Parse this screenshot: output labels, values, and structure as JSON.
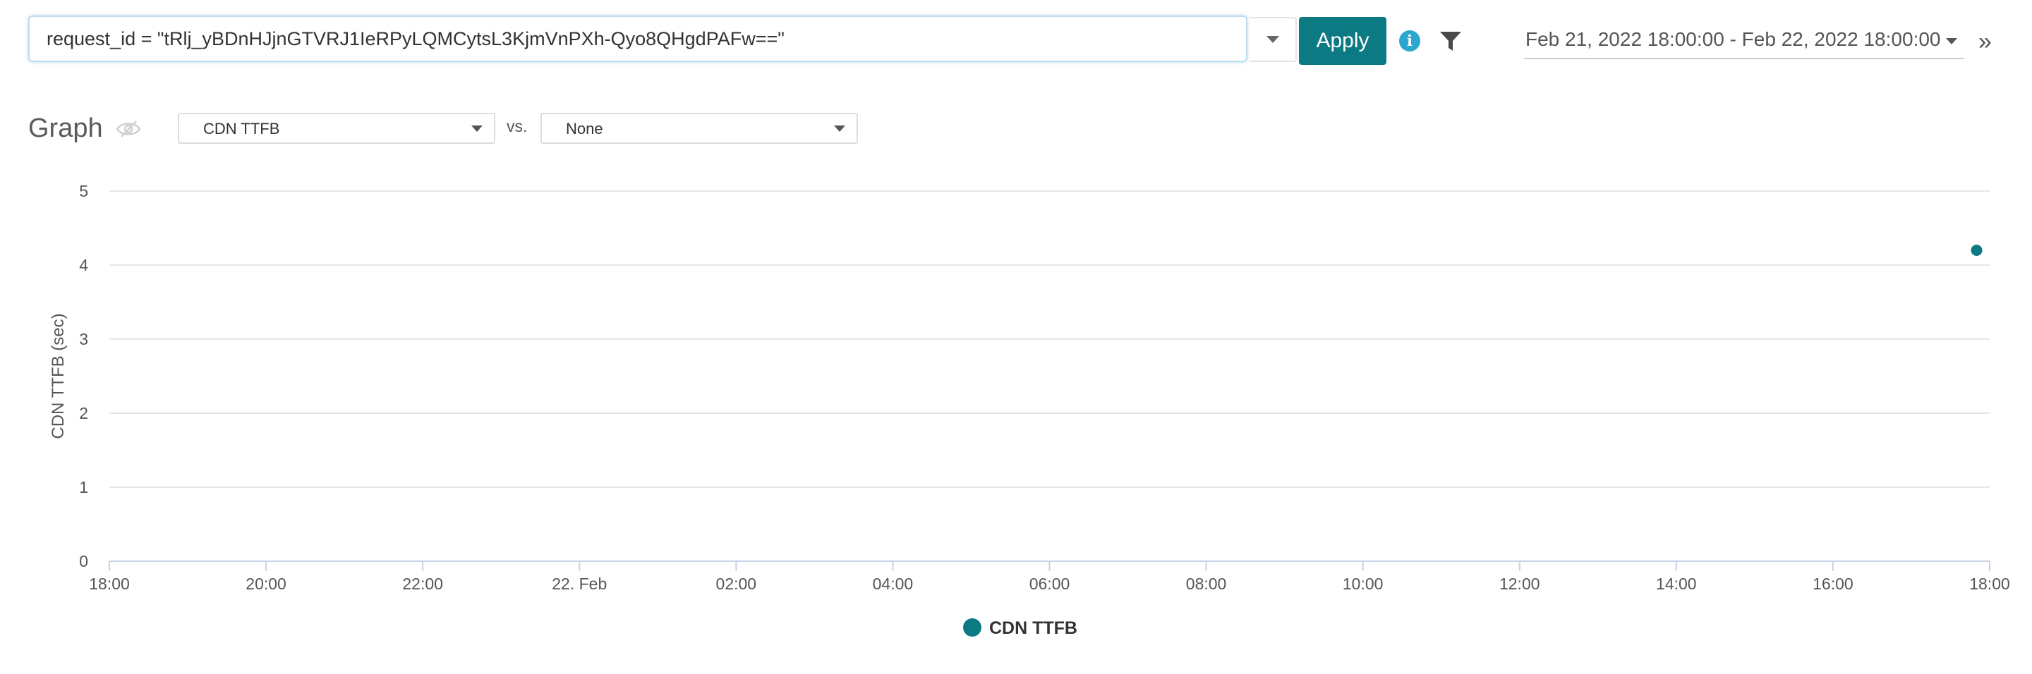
{
  "query": {
    "value": "request_id = \"tRlj_yBDnHJjnGTVRJ1IeRPyLQMCytsL3KjmVnPXh-Qyo8QHgdPAFw==\"",
    "apply_label": "Apply"
  },
  "date_range": {
    "label": "Feb 21, 2022 18:00:00 - Feb 22, 2022 18:00:00"
  },
  "icons": {
    "info": "info-icon",
    "filter": "filter-icon",
    "collapse": "double-chevron-right-icon",
    "visibility": "eye-slash-icon",
    "dropdown": "caret-down-icon",
    "info_glyph": "i",
    "collapse_glyph": "»"
  },
  "graph": {
    "title": "Graph",
    "metric_selected": "CDN TTFB",
    "vs_label": "vs.",
    "compare_selected": "None"
  },
  "colors": {
    "accent": "#0b7a83",
    "info": "#2aa7cf",
    "series": "#0b7a83",
    "grid": "#e6e6e6"
  },
  "chart_data": {
    "type": "scatter",
    "ylabel": "CDN TTFB (sec)",
    "xlabel": "",
    "ylim": [
      0,
      5
    ],
    "yticks": [
      "0",
      "1",
      "2",
      "3",
      "4",
      "5"
    ],
    "xlim": [
      "2022-02-21 18:00",
      "2022-02-22 18:00"
    ],
    "xticks": [
      "18:00",
      "20:00",
      "22:00",
      "22. Feb",
      "02:00",
      "04:00",
      "06:00",
      "08:00",
      "10:00",
      "12:00",
      "14:00",
      "16:00",
      "18:00"
    ],
    "grid": true,
    "legend_position": "bottom-center",
    "series": [
      {
        "name": "CDN TTFB",
        "points": [
          {
            "x": "2022-02-22 17:50",
            "y": 4.2
          }
        ]
      }
    ]
  }
}
